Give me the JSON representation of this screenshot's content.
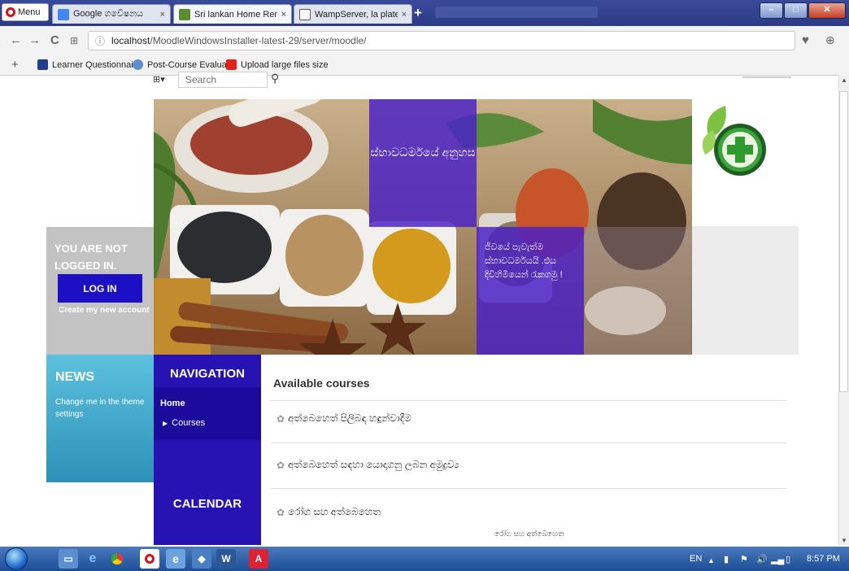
{
  "browser": {
    "menu_label": "Menu",
    "tabs": [
      {
        "label": "Google ගවේෂනය",
        "close": "×"
      },
      {
        "label": "Sri lankan Home Remedies",
        "close": "×"
      },
      {
        "label": "WampServer, la plate-form",
        "close": "×"
      }
    ],
    "new_tab": "+",
    "address": {
      "host": "localhost",
      "path": "/MoodleWindowsInstaller-latest-29/server/moodle/"
    },
    "bookmarks": [
      "Learner Questionnair",
      "Post-Course Evaluatic",
      "Upload large files size"
    ],
    "add_bookmark": "+"
  },
  "page": {
    "search": {
      "placeholder": "Search",
      "lang_icon": "⊞▾",
      "button": "🔍"
    },
    "hero": {
      "text1": "ස්භාවධර්මයේ අනුහස",
      "text2": "ජීවයේ පැවැත්ම ස්භාවධර්මයයි .එය දිවිහිමියෙන් රැකගමු !"
    },
    "login": {
      "title": "YOU ARE NOT LOGGED IN.",
      "button": "LOG IN",
      "create": "Create my new account"
    },
    "news": {
      "title": "NEWS",
      "text": "Change me in the theme settings"
    },
    "navigation": {
      "title": "NAVIGATION",
      "home": "Home",
      "courses": "Courses",
      "calendar": "CALENDAR"
    },
    "courses": {
      "title": "Available courses",
      "items": [
        "අත්බෙහෙත් පිලිබඳ හඳුන්වාදීම",
        "අත්බෙහෙත් සඳහා යොදාගනු ලබන අමුද්‍රව්‍ය",
        "රෝග සහ අත්බෙහෙත"
      ],
      "summary": "රෝග සහ අත්බෙහෙත"
    }
  },
  "taskbar": {
    "lang": "EN",
    "time": "8:57 PM"
  },
  "colors": {
    "nav_blue": "#2712b3",
    "login_btn": "#1d0fc3",
    "news_cyan": "#4fb6d8",
    "hero_purple": "#4a1ec8"
  }
}
